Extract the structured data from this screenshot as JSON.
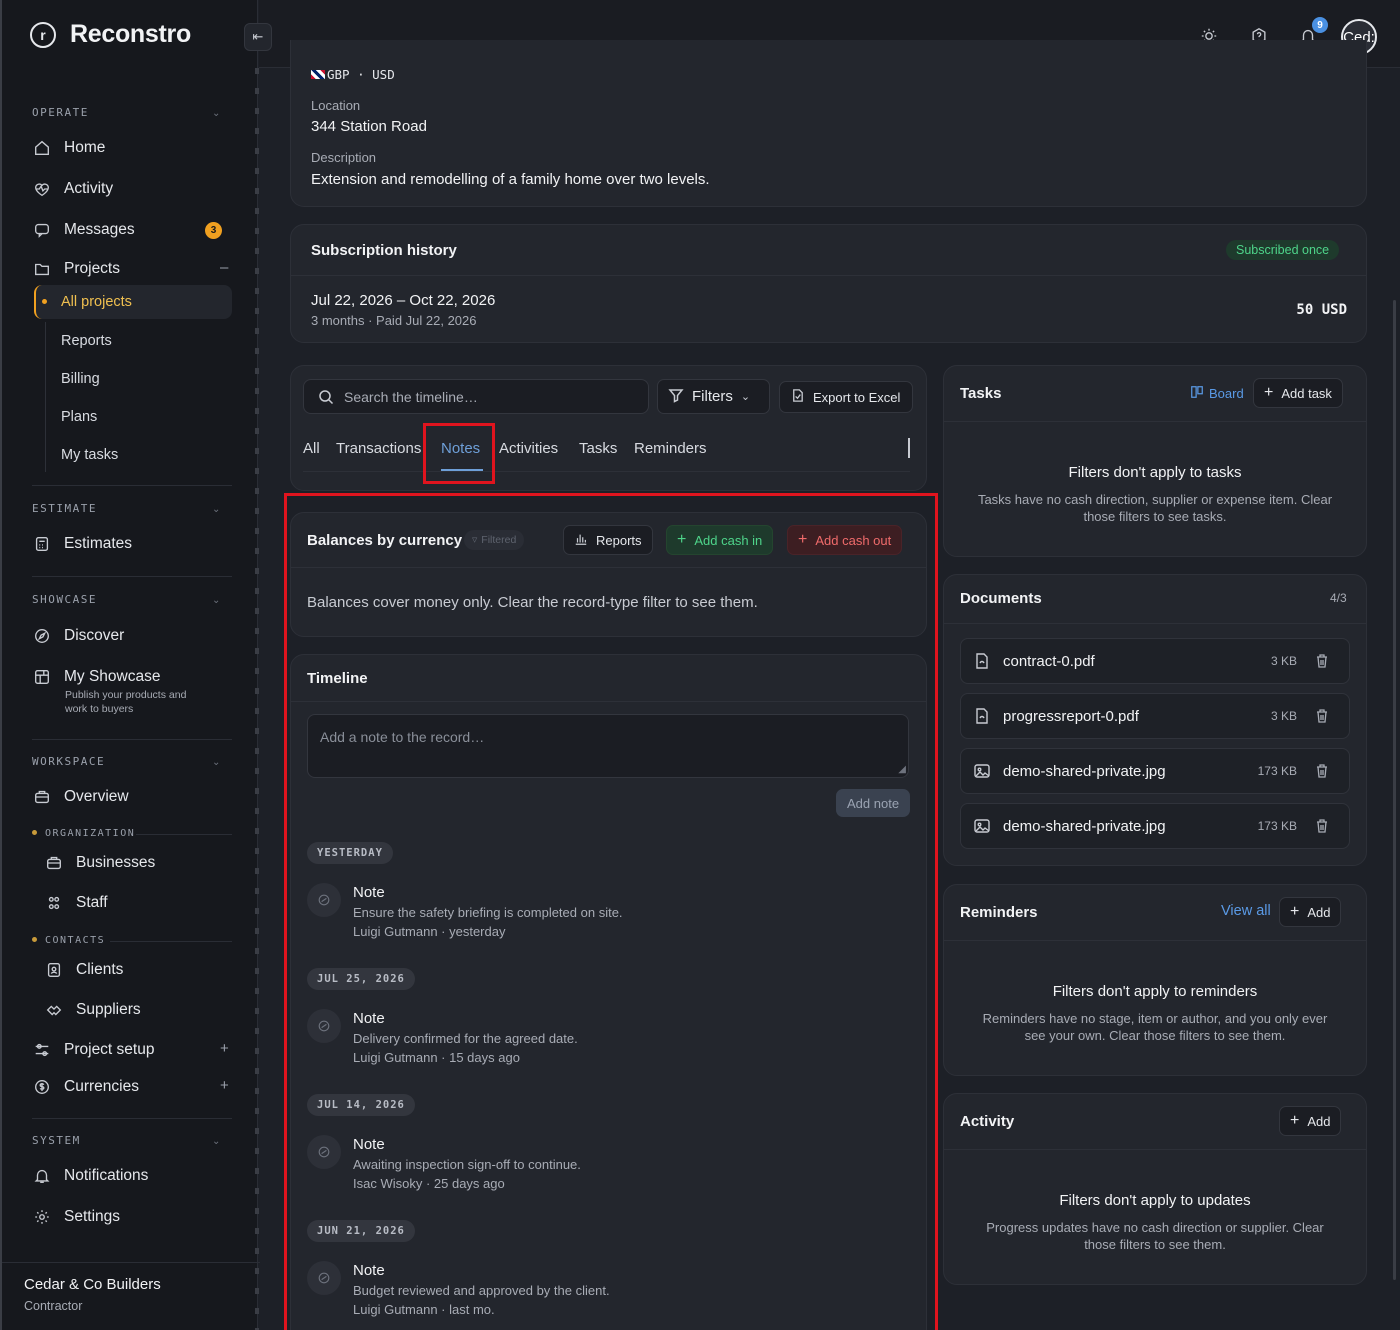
{
  "brand": {
    "name": "Reconstro",
    "logo_letter": "r"
  },
  "sidebar": {
    "operate_label": "OPERATE",
    "items_operate": [
      {
        "label": "Home",
        "icon": "home-icon"
      },
      {
        "label": "Activity",
        "icon": "heartbeat-icon"
      },
      {
        "label": "Messages",
        "icon": "chat-icon",
        "badge": "3"
      },
      {
        "label": "Projects",
        "icon": "folder-icon"
      }
    ],
    "projects_sub": [
      "All projects",
      "Reports",
      "Billing",
      "Plans",
      "My tasks"
    ],
    "estimate_label": "ESTIMATE",
    "estimates": "Estimates",
    "showcase_label": "SHOWCASE",
    "discover": "Discover",
    "my_showcase": "My Showcase",
    "my_showcase_desc": "Publish your products and work to buyers",
    "workspace_label": "WORKSPACE",
    "overview": "Overview",
    "organization_label": "ORGANIZATION",
    "businesses": "Businesses",
    "staff": "Staff",
    "contacts_label": "CONTACTS",
    "clients": "Clients",
    "suppliers": "Suppliers",
    "project_setup": "Project setup",
    "currencies": "Currencies",
    "system_label": "SYSTEM",
    "notifications": "Notifications",
    "settings": "Settings",
    "company_name": "Cedar & Co Builders",
    "company_role": "Contractor"
  },
  "topbar": {
    "notif_count": "9",
    "avatar_text": "Ced:"
  },
  "project": {
    "currency": "GBP · USD",
    "location_label": "Location",
    "location": "344 Station Road",
    "description_label": "Description",
    "description": "Extension and remodelling of a family home over two levels."
  },
  "subscription": {
    "title": "Subscription history",
    "status": "Subscribed once",
    "period": "Jul 22, 2026 – Oct 22, 2026",
    "detail": "3 months · Paid Jul 22, 2026",
    "amount": "50 USD"
  },
  "timeline_controls": {
    "search_placeholder": "Search the timeline…",
    "filters": "Filters",
    "export": "Export to Excel",
    "tabs": [
      "All",
      "Transactions",
      "Notes",
      "Activities",
      "Tasks",
      "Reminders"
    ],
    "active_tab": "Notes"
  },
  "balances": {
    "title": "Balances by currency",
    "filtered": "Filtered",
    "reports": "Reports",
    "add_in": "Add cash in",
    "add_out": "Add cash out",
    "message": "Balances cover money only. Clear the record-type filter to see them."
  },
  "timeline": {
    "title": "Timeline",
    "note_placeholder": "Add a note to the record…",
    "add_note": "Add note",
    "groups": [
      {
        "date": "YESTERDAY",
        "title": "Note",
        "body": "Ensure the safety briefing is completed on site.",
        "meta": "Luigi Gutmann · yesterday"
      },
      {
        "date": "JUL 25, 2026",
        "title": "Note",
        "body": "Delivery confirmed for the agreed date.",
        "meta": "Luigi Gutmann · 15 days ago"
      },
      {
        "date": "JUL 14, 2026",
        "title": "Note",
        "body": "Awaiting inspection sign-off to continue.",
        "meta": "Isac Wisoky · 25 days ago"
      },
      {
        "date": "JUN 21, 2026",
        "title": "Note",
        "body": "Budget reviewed and approved by the client.",
        "meta": "Luigi Gutmann · last mo."
      }
    ]
  },
  "tasks": {
    "title": "Tasks",
    "board": "Board",
    "add": "Add task",
    "empty_title": "Filters don't apply to tasks",
    "empty_body": "Tasks have no cash direction, supplier or expense item. Clear those filters to see tasks."
  },
  "documents": {
    "title": "Documents",
    "count": "4/3",
    "files": [
      {
        "name": "contract-0.pdf",
        "size": "3 KB",
        "kind": "pdf"
      },
      {
        "name": "progressreport-0.pdf",
        "size": "3 KB",
        "kind": "pdf"
      },
      {
        "name": "demo-shared-private.jpg",
        "size": "173 KB",
        "kind": "image"
      },
      {
        "name": "demo-shared-private.jpg",
        "size": "173 KB",
        "kind": "image"
      }
    ]
  },
  "reminders": {
    "title": "Reminders",
    "view_all": "View all",
    "add": "Add",
    "empty_title": "Filters don't apply to reminders",
    "empty_body": "Reminders have no stage, item or author, and you only ever see your own. Clear those filters to see them."
  },
  "activity": {
    "title": "Activity",
    "add": "Add",
    "empty_title": "Filters don't apply to updates",
    "empty_body": "Progress updates have no cash direction or supplier. Clear those filters to see them."
  }
}
